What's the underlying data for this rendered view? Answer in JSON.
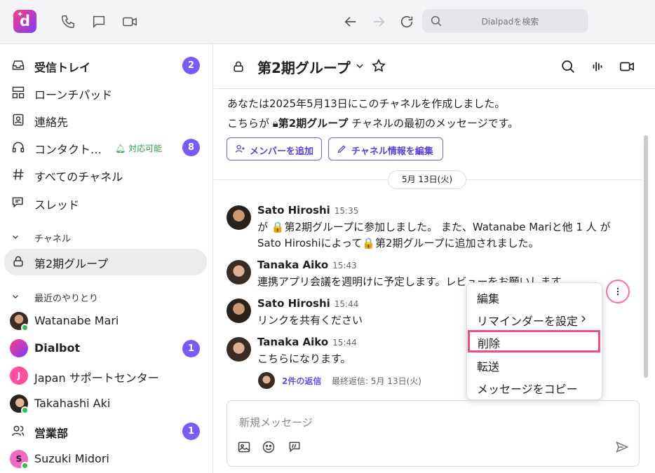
{
  "topbar": {
    "logo_letter": "d",
    "search_placeholder": "Dialpadを検索"
  },
  "sidebar": {
    "items": [
      {
        "label": "受信トレイ",
        "badge": "2",
        "icon": "inbox-icon"
      },
      {
        "label": "ローンチパッド",
        "icon": "launchpad-icon"
      },
      {
        "label": "連絡先",
        "icon": "contacts-icon"
      },
      {
        "label": "コンタクト…",
        "status": "対応可能",
        "badge": "8",
        "icon": "headset-icon"
      },
      {
        "label": "すべてのチャネル",
        "icon": "hash-icon"
      },
      {
        "label": "スレッド",
        "icon": "threads-icon"
      }
    ],
    "channels_heading": "チャネル",
    "channel_active": "第2期グループ",
    "recent_heading": "最近のやりとり",
    "recent": [
      {
        "label": "Watanabe Mari"
      },
      {
        "label": "Dialbot",
        "badge": "1"
      },
      {
        "label": "Japan サポートセンター",
        "initial": "J"
      },
      {
        "label": "Takahashi Aki"
      },
      {
        "label": "営業部",
        "badge": "1"
      },
      {
        "label": "Suzuki Midori",
        "initial": "S"
      }
    ]
  },
  "channel": {
    "title": "第2期グループ",
    "intro_line1": "あなたは2025年5月13日にこのチャネルを作成しました。",
    "intro_line2_prefix": "こちらが",
    "intro_line2_channel": "第2期グループ",
    "intro_line2_suffix": "チャネルの最初のメッセージです。",
    "add_member": "メンバーを追加",
    "edit_info": "チャネル情報を編集",
    "date_divider": "5月 13日(火)"
  },
  "messages": [
    {
      "name": "Sato Hiroshi",
      "time": "15:35",
      "line1": "が 🔒第2期グループに参加しました。 また、Watanabe Mariと他 1 人 が",
      "line2": "Sato Hiroshiによって🔒第2期グループに追加されました。"
    },
    {
      "name": "Tanaka Aiko",
      "time": "15:43",
      "line1": "連携アプリ会議を週明けに予定します。レビューをお願いします。"
    },
    {
      "name": "Sato Hiroshi",
      "time": "15:44",
      "line1": "リンクを共有ください"
    },
    {
      "name": "Tanaka Aiko",
      "time": "15:44",
      "line1": "こちらになります。"
    }
  ],
  "thread": {
    "count": "2件の返信",
    "last": "最終返信: 5月 13日(火)"
  },
  "context_menu": {
    "items": [
      "編集",
      "リマインダーを設定",
      "削除",
      "転送",
      "メッセージをコピー"
    ]
  },
  "composer": {
    "placeholder": "新規メッセージ"
  },
  "colors": {
    "accent": "#7a5af8",
    "highlight": "#ee4d8a",
    "online": "#2ec24b"
  }
}
